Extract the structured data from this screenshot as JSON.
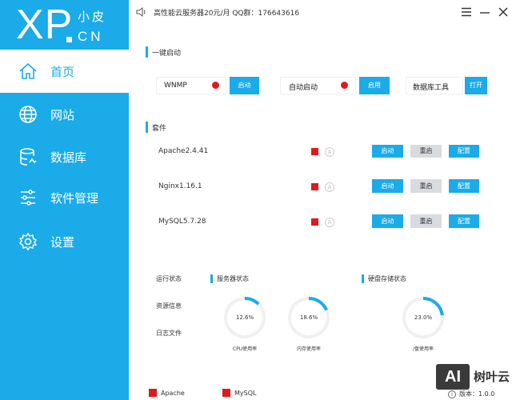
{
  "logo": {
    "main": "XP",
    "name": "小皮",
    "suffix": "CN"
  },
  "nav": [
    {
      "label": "首页",
      "icon": "home-icon",
      "active": true
    },
    {
      "label": "网站",
      "icon": "globe-icon"
    },
    {
      "label": "数据库",
      "icon": "database-icon"
    },
    {
      "label": "软件管理",
      "icon": "sliders-icon"
    },
    {
      "label": "设置",
      "icon": "gear-icon"
    }
  ],
  "topbar": {
    "notice": "高性能云服务器20元/月  QQ群：176643616"
  },
  "quick_start": {
    "title": "一键启动",
    "items": [
      {
        "label": "WNMP",
        "button": "启动",
        "status_color": "#e0191c"
      },
      {
        "label": "自动启动",
        "button": "启用",
        "status_color": "#e0191c"
      },
      {
        "label": "数据库工具",
        "button": "打开"
      }
    ]
  },
  "suite": {
    "title": "套件",
    "rows": [
      {
        "name": "Apache2.4.41",
        "start": "启动",
        "restart": "重启",
        "config": "配置"
      },
      {
        "name": "Nginx1.16.1",
        "start": "启动",
        "restart": "重启",
        "config": "配置"
      },
      {
        "name": "MySQL5.7.28",
        "start": "启动",
        "restart": "重启",
        "config": "配置"
      }
    ],
    "auto_icon_label": "A"
  },
  "status": {
    "links": [
      "运行状态",
      "资源信息",
      "日志文件"
    ],
    "server_title": "服务器状态",
    "disk_title": "硬盘存储状态",
    "gauges": [
      {
        "value_text": "12.6%",
        "value": 12.6,
        "caption": "CPU使用率"
      },
      {
        "value_text": "18.6%",
        "value": 18.6,
        "caption": "内存使用率"
      },
      {
        "value_text": "23.0%",
        "value": 23.0,
        "caption": "/盘使用率"
      }
    ]
  },
  "footer": {
    "legend": [
      "Apache",
      "MySQL"
    ],
    "version": "版本：1.0.0"
  },
  "watermark": {
    "box": "AI",
    "text": "树叶云"
  },
  "colors": {
    "accent": "#1aabe8",
    "status_off": "#e0191c",
    "button_gray": "#d8dbe0"
  }
}
